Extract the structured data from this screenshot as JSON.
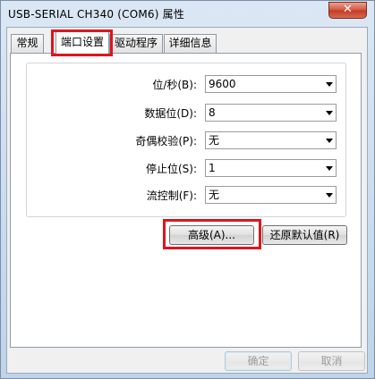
{
  "window": {
    "title": "USB-SERIAL CH340 (COM6) 属性",
    "close_label": "✕"
  },
  "tabs": [
    {
      "label": "常规"
    },
    {
      "label": "端口设置"
    },
    {
      "label": "驱动程序"
    },
    {
      "label": "详细信息"
    }
  ],
  "settings": {
    "bits_per_second": {
      "label": "位/秒(B):",
      "value": "9600"
    },
    "data_bits": {
      "label": "数据位(D):",
      "value": "8"
    },
    "parity": {
      "label": "奇偶校验(P):",
      "value": "无"
    },
    "stop_bits": {
      "label": "停止位(S):",
      "value": "1"
    },
    "flow_control": {
      "label": "流控制(F):",
      "value": "无"
    }
  },
  "buttons": {
    "advanced": "高级(A)...",
    "restore_defaults": "还原默认值(R)",
    "ok": "确定",
    "cancel": "取消"
  },
  "colors": {
    "highlight": "#e0141e",
    "close_button": "#c23a22"
  },
  "icons": {
    "dropdown": "chevron-down-icon",
    "close": "close-icon"
  }
}
